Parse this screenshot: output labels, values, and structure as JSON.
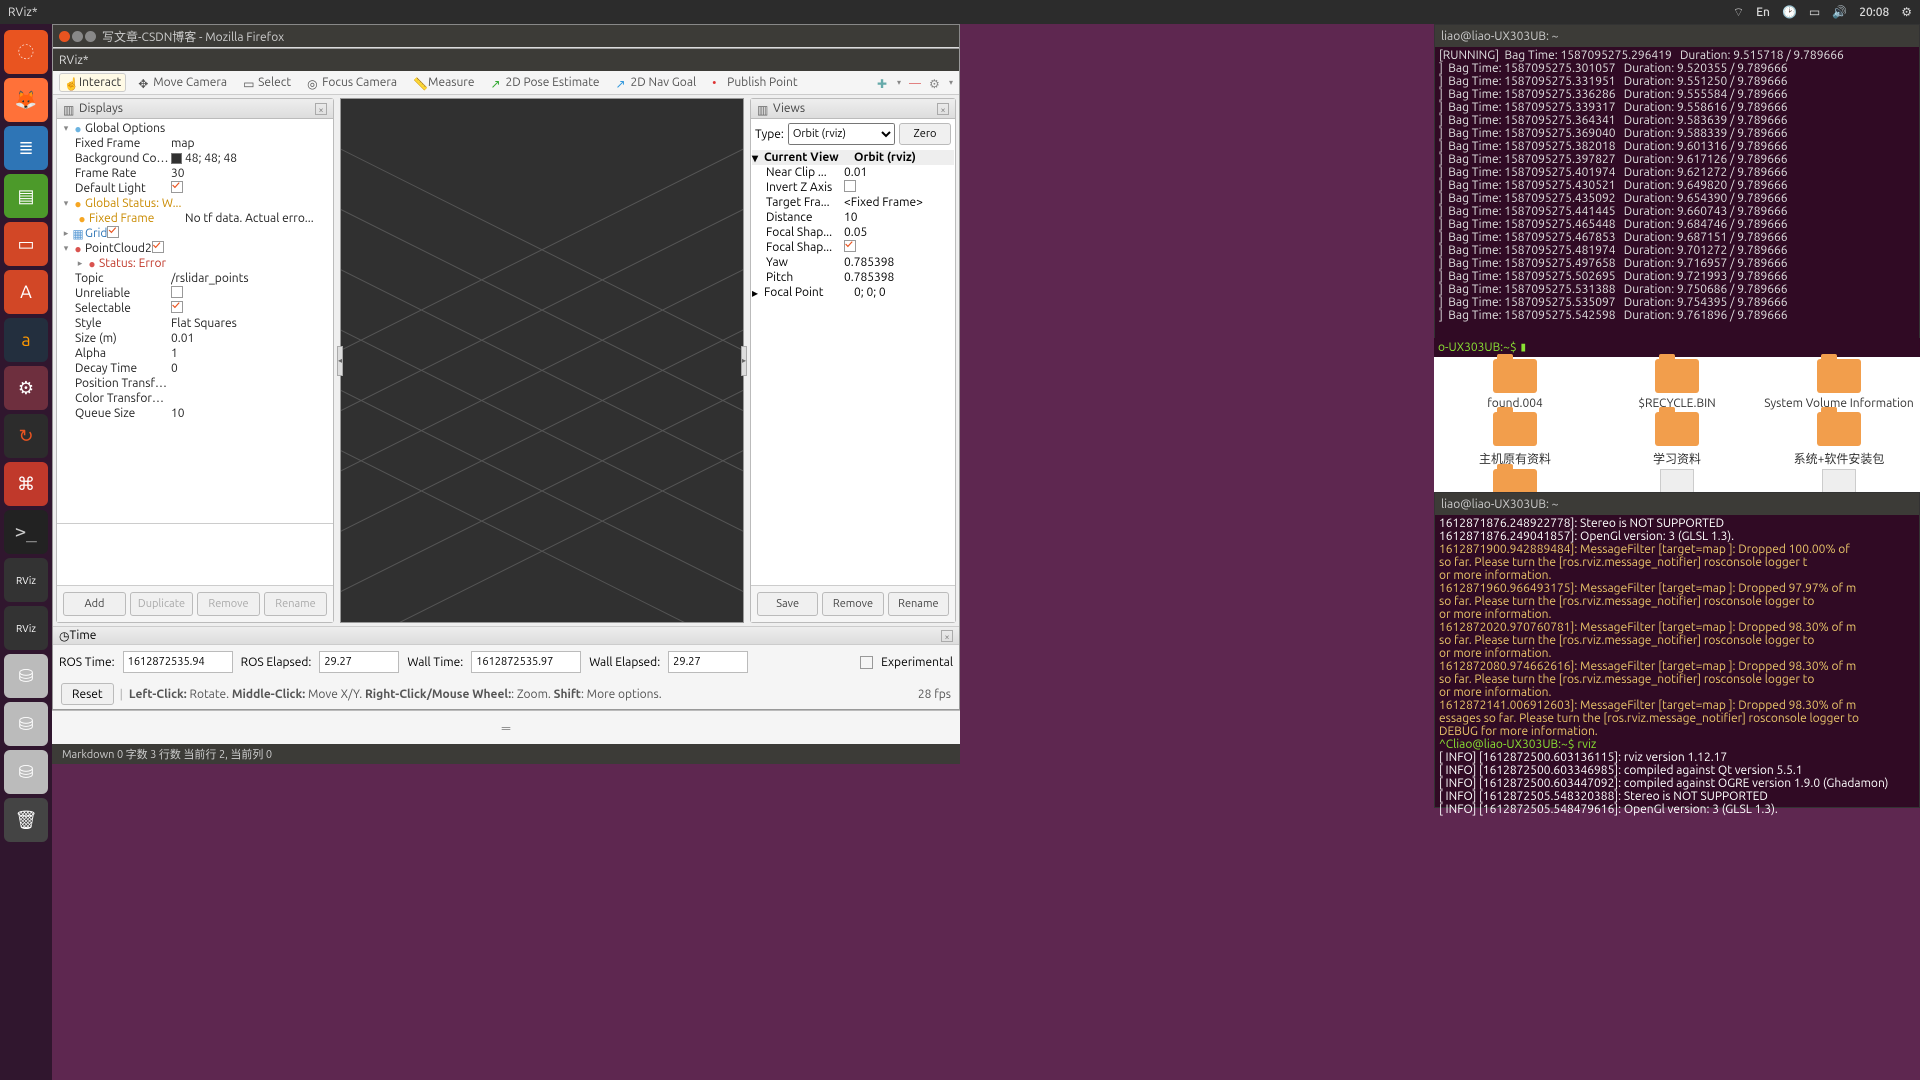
{
  "topbar": {
    "title": "RViz*",
    "lang": "En",
    "time": "20:08"
  },
  "launcher": [
    {
      "n": "ubuntu-dash",
      "cls": "ubuntu",
      "g": "◌"
    },
    {
      "n": "firefox",
      "cls": "ff",
      "g": "🦊"
    },
    {
      "n": "writer",
      "cls": "writer",
      "g": "≣"
    },
    {
      "n": "calc",
      "cls": "green",
      "g": "▤"
    },
    {
      "n": "impress",
      "cls": "impress",
      "g": "▭"
    },
    {
      "n": "software",
      "cls": "impress",
      "g": "A"
    },
    {
      "n": "amazon",
      "cls": "amazon",
      "g": "a"
    },
    {
      "n": "settings",
      "cls": "settings",
      "g": "⚙"
    },
    {
      "n": "updater",
      "cls": "update",
      "g": "↻"
    },
    {
      "n": "reader",
      "cls": "red",
      "g": "⌘"
    },
    {
      "n": "terminal",
      "cls": "term",
      "g": ">_"
    },
    {
      "n": "rviz-app-1",
      "cls": "rviz",
      "g": "RViz"
    },
    {
      "n": "rviz-app-2",
      "cls": "rviz",
      "g": "RViz"
    },
    {
      "n": "drive-1",
      "cls": "drive",
      "g": "⛁"
    },
    {
      "n": "drive-2",
      "cls": "drive",
      "g": "⛁"
    },
    {
      "n": "drive-3",
      "cls": "drive",
      "g": "⛁"
    },
    {
      "n": "trash",
      "cls": "trash",
      "g": "🗑"
    }
  ],
  "firefox_title": "写文章-CSDN博客 - Mozilla Firefox",
  "rviz": {
    "title": "RViz*",
    "toolbar": {
      "interact": "Interact",
      "move": "Move Camera",
      "select": "Select",
      "focus": "Focus Camera",
      "measure": "Measure",
      "pose": "2D Pose Estimate",
      "nav": "2D Nav Goal",
      "publish": "Publish Point"
    },
    "displays_title": "Displays",
    "tree": {
      "global_options": "Global Options",
      "fixed_frame_lbl": "Fixed Frame",
      "fixed_frame_val": "map",
      "bg_lbl": "Background Color",
      "bg_val": "48; 48; 48",
      "fr_lbl": "Frame Rate",
      "fr_val": "30",
      "dl_lbl": "Default Light",
      "gstatus": "Global Status: W...",
      "ff_status_lbl": "Fixed Frame",
      "ff_status_val": "No tf data.  Actual erro...",
      "grid": "Grid",
      "pc": "PointCloud2",
      "se": "Status: Error",
      "topic_lbl": "Topic",
      "topic_val": "/rslidar_points",
      "unrel": "Unreliable",
      "sel": "Selectable",
      "style_lbl": "Style",
      "style_val": "Flat Squares",
      "size_lbl": "Size (m)",
      "size_val": "0.01",
      "alpha_lbl": "Alpha",
      "alpha_val": "1",
      "decay_lbl": "Decay Time",
      "decay_val": "0",
      "pt_lbl": "Position Transfor...",
      "ct_lbl": "Color Transformer",
      "q_lbl": "Queue Size",
      "q_val": "10"
    },
    "buttons": {
      "add": "Add",
      "dup": "Duplicate",
      "rem": "Remove",
      "ren": "Rename",
      "save": "Save",
      "vrem": "Remove",
      "vren": "Rename"
    },
    "views": {
      "title": "Views",
      "type_lbl": "Type:",
      "type_val": "Orbit (rviz)",
      "zero": "Zero",
      "cur": "Current View",
      "cur_v": "Orbit (rviz)",
      "near": "Near Clip ...",
      "near_v": "0.01",
      "inv": "Invert Z Axis",
      "tf": "Target Fra...",
      "tf_v": "<Fixed Frame>",
      "dist": "Distance",
      "dist_v": "10",
      "fs1": "Focal Shap...",
      "fs1_v": "0.05",
      "fs2": "Focal Shap...",
      "yaw": "Yaw",
      "yaw_v": "0.785398",
      "pitch": "Pitch",
      "pitch_v": "0.785398",
      "fp": "Focal Point",
      "fp_v": "0; 0; 0"
    },
    "time": {
      "title": "Time",
      "ros_lbl": "ROS Time:",
      "ros_val": "1612872535.94",
      "rose_lbl": "ROS Elapsed:",
      "rose_val": "29.27",
      "wall_lbl": "Wall Time:",
      "wall_val": "1612872535.97",
      "walle_lbl": "Wall Elapsed:",
      "walle_val": "29.27",
      "exp": "Experimental"
    },
    "status": {
      "reset": "Reset",
      "hint": "Left-Click: Rotate.  Middle-Click: Move X/Y.  Right-Click/Mouse Wheel:: Zoom.  Shift: More options.",
      "fps": "28 fps"
    }
  },
  "editor_status": "Markdown   0 字数   3 行数   当前行 2, 当前列 0",
  "term_a": {
    "title": "liao@liao-UX303UB: ~",
    "running": "[RUNNING]",
    "rows": [
      [
        "1587095275.296419",
        "9.515718"
      ],
      [
        "1587095275.301057",
        "9.520355"
      ],
      [
        "1587095275.331951",
        "9.551250"
      ],
      [
        "1587095275.336286",
        "9.555584"
      ],
      [
        "1587095275.339317",
        "9.558616"
      ],
      [
        "1587095275.364341",
        "9.583639"
      ],
      [
        "1587095275.369040",
        "9.588339"
      ],
      [
        "1587095275.382018",
        "9.601316"
      ],
      [
        "1587095275.397827",
        "9.617126"
      ],
      [
        "1587095275.401974",
        "9.621272"
      ],
      [
        "1587095275.430521",
        "9.649820"
      ],
      [
        "1587095275.435092",
        "9.654390"
      ],
      [
        "1587095275.441445",
        "9.660743"
      ],
      [
        "1587095275.465448",
        "9.684746"
      ],
      [
        "1587095275.467853",
        "9.687151"
      ],
      [
        "1587095275.481974",
        "9.701272"
      ],
      [
        "1587095275.497658",
        "9.716957"
      ],
      [
        "1587095275.502695",
        "9.721993"
      ],
      [
        "1587095275.531388",
        "9.750686"
      ],
      [
        "1587095275.535097",
        "9.754395"
      ],
      [
        "1587095275.542598",
        "9.761896"
      ]
    ],
    "dur2": "9.789666",
    "prompt": "o-UX303UB:~$ "
  },
  "nautilus": {
    "row1": [
      {
        "n": "found.004",
        "t": "folder"
      },
      {
        "n": "$RECYCLE.BIN",
        "t": "folder"
      },
      {
        "n": "System Volume Information",
        "t": "folder"
      }
    ],
    "row2": [
      {
        "n": "主机原有资料",
        "t": "folder"
      },
      {
        "n": "学习资料",
        "t": "folder"
      },
      {
        "n": "系统+软件安装包",
        "t": "folder"
      }
    ],
    "row3": [
      {
        "n": "",
        "t": "folder"
      },
      {
        "n": "",
        "t": "file"
      },
      {
        "n": "",
        "t": "bin"
      }
    ]
  },
  "term_b": {
    "title": "liao@liao-UX303UB: ~",
    "lines": [
      {
        "c": "info",
        "t": "1612871876.248922778]: Stereo is NOT SUPPORTED"
      },
      {
        "c": "info",
        "t": "1612871876.249041857]: OpenGl version: 3 (GLSL 1.3)."
      },
      {
        "c": "warn",
        "t": "1612871900.942889484]: MessageFilter [target=map ]: Dropped 100.00% of"
      },
      {
        "c": "warn",
        "t": "so far. Please turn the [ros.rviz.message_notifier] rosconsole logger t"
      },
      {
        "c": "warn",
        "t": "or more information."
      },
      {
        "c": "warn",
        "t": "1612871960.966493175]: MessageFilter [target=map ]: Dropped 97.97% of m"
      },
      {
        "c": "warn",
        "t": "so far. Please turn the [ros.rviz.message_notifier] rosconsole logger to"
      },
      {
        "c": "warn",
        "t": "or more information."
      },
      {
        "c": "warn",
        "t": "1612872020.970760781]: MessageFilter [target=map ]: Dropped 98.30% of m"
      },
      {
        "c": "warn",
        "t": "so far. Please turn the [ros.rviz.message_notifier] rosconsole logger to"
      },
      {
        "c": "warn",
        "t": "or more information."
      },
      {
        "c": "warn",
        "t": "1612872080.974662616]: MessageFilter [target=map ]: Dropped 98.30% of m"
      },
      {
        "c": "warn",
        "t": "so far. Please turn the [ros.rviz.message_notifier] rosconsole logger to"
      },
      {
        "c": "warn",
        "t": "or more information."
      },
      {
        "c": "warn",
        "t": "1612872141.006912603]: MessageFilter [target=map ]: Dropped 98.30% of m"
      },
      {
        "c": "warn",
        "t": "essages so far. Please turn the [ros.rviz.message_notifier] rosconsole logger to"
      },
      {
        "c": "warn",
        "t": "DEBUG for more information."
      },
      {
        "c": "prompt",
        "t": "^Cliao@liao-UX303UB:~$ rviz"
      },
      {
        "c": "info",
        "t": "[ INFO] [1612872500.603136115]: rviz version 1.12.17"
      },
      {
        "c": "info",
        "t": "[ INFO] [1612872500.603346985]: compiled against Qt version 5.5.1"
      },
      {
        "c": "info",
        "t": "[ INFO] [1612872500.603447092]: compiled against OGRE version 1.9.0 (Ghadamon)"
      },
      {
        "c": "info",
        "t": "[ INFO] [1612872505.548320388]: Stereo is NOT SUPPORTED"
      },
      {
        "c": "info",
        "t": "[ INFO] [1612872505.548479616]: OpenGl version: 3 (GLSL 1.3)."
      }
    ]
  }
}
